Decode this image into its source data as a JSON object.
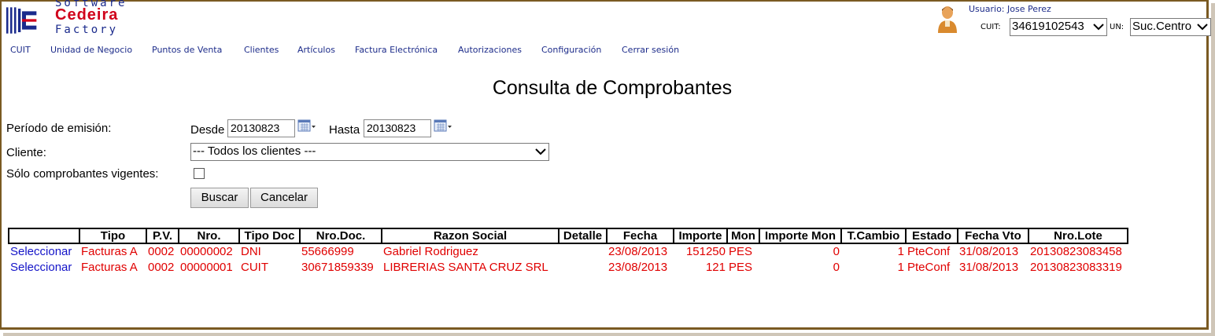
{
  "logo": {
    "line1": "Software",
    "line2": "Cedeira",
    "line3": "Factory"
  },
  "menu": [
    "CUIT",
    "Unidad de Negocio",
    "Puntos de Venta",
    "Clientes",
    "Artículos",
    "Factura Electrónica",
    "Autorizaciones",
    "Configuración",
    "Cerrar sesión"
  ],
  "user": {
    "label": "Usuario: Jose Perez",
    "cuit_label": "CUIT:",
    "cuit_value": "34619102543",
    "un_label": "UN:",
    "un_value": "Suc.Centro"
  },
  "page_title": "Consulta de Comprobantes",
  "form": {
    "periodo_label": "Período de emisión:",
    "desde_label": "Desde",
    "desde_value": "20130823",
    "hasta_label": "Hasta",
    "hasta_value": "20130823",
    "cliente_label": "Cliente:",
    "cliente_value": "--- Todos los clientes ---",
    "vigentes_label": "Sólo comprobantes vigentes:",
    "vigentes_checked": false,
    "buscar_label": "Buscar",
    "cancelar_label": "Cancelar"
  },
  "table": {
    "columns": [
      "",
      "Tipo",
      "P.V.",
      "Nro.",
      "Tipo Doc",
      "Nro.Doc.",
      "Razon Social",
      "Detalle",
      "Fecha",
      "Importe",
      "Mon",
      "Importe Mon",
      "T.Cambio",
      "Estado",
      "Fecha Vto",
      "Nro.Lote"
    ],
    "rows": [
      [
        "Seleccionar",
        "Facturas A",
        "0002",
        "00000002",
        "DNI",
        "55666999",
        "Gabriel Rodriguez",
        "",
        "23/08/2013",
        "151250",
        "PES",
        "0",
        "1",
        "PteConf",
        "31/08/2013",
        "20130823083458"
      ],
      [
        "Seleccionar",
        "Facturas A",
        "0002",
        "00000001",
        "CUIT",
        "30671859339",
        "LIBRERIAS SANTA CRUZ SRL",
        "",
        "23/08/2013",
        "121",
        "PES",
        "0",
        "1",
        "PteConf",
        "31/08/2013",
        "20130823083319"
      ]
    ]
  },
  "colors": {
    "menu": "#1d2c8a",
    "row_text": "#e00000",
    "select_link": "#1414c8",
    "frame": "#7a5a22"
  }
}
